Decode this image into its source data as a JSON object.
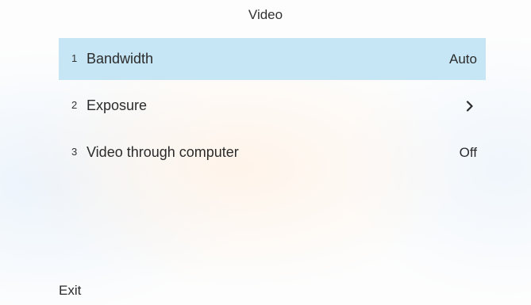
{
  "menu": {
    "title": "Video",
    "items": [
      {
        "number": "1",
        "label": "Bandwidth",
        "value": "Auto",
        "selected": true
      },
      {
        "number": "2",
        "label": "Exposure",
        "value": "",
        "icon": "chevron-right-icon"
      },
      {
        "number": "3",
        "label": "Video through computer",
        "value": "Off"
      }
    ]
  },
  "footer": {
    "exit_label": "Exit"
  },
  "colors": {
    "selected_row": "#c6e6f5",
    "text": "#2b2b2b"
  }
}
